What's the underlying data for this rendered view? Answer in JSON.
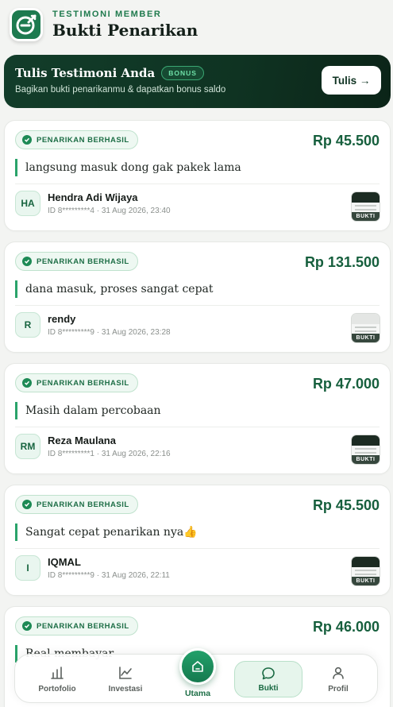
{
  "header": {
    "eyebrow": "TESTIMONI MEMBER",
    "title": "Bukti Penarikan"
  },
  "banner": {
    "title": "Tulis Testimoni Anda",
    "badge": "BONUS",
    "subtitle": "Bagikan bukti penarikanmu & dapatkan bonus saldo",
    "button_label": "Tulis →"
  },
  "cards": [
    {
      "status": "PENARIKAN BERHASIL",
      "amount": "Rp 45.500",
      "message": "langsung masuk dong gak pakek lama",
      "initials": "HA",
      "name": "Hendra Adi Wijaya",
      "meta": "ID 8*********4 · 31 Aug 2026, 23:40",
      "proof_label": "BUKTI"
    },
    {
      "status": "PENARIKAN BERHASIL",
      "amount": "Rp 131.500",
      "message": "dana masuk, proses sangat cepat",
      "initials": "R",
      "name": "rendy",
      "meta": "ID 8*********9 · 31 Aug 2026, 23:28",
      "proof_label": "BUKTI"
    },
    {
      "status": "PENARIKAN BERHASIL",
      "amount": "Rp 47.000",
      "message": "Masih dalam percobaan",
      "initials": "RM",
      "name": "Reza Maulana",
      "meta": "ID 8*********1 · 31 Aug 2026, 22:16",
      "proof_label": "BUKTI"
    },
    {
      "status": "PENARIKAN BERHASIL",
      "amount": "Rp 45.500",
      "message": "Sangat cepat penarikan nya👍",
      "initials": "I",
      "name": "IQMAL",
      "meta": "ID 8*********9 · 31 Aug 2026, 22:11",
      "proof_label": "BUKTI"
    },
    {
      "status": "PENARIKAN BERHASIL",
      "amount": "Rp 46.000",
      "message": "Real membayar"
    }
  ],
  "nav": {
    "portfolio": "Portofolio",
    "investasi": "Investasi",
    "utama": "Utama",
    "bukti": "Bukti",
    "profil": "Profil"
  },
  "colors": {
    "accent": "#1d8a55",
    "banner_bg": "#0f3322",
    "amount": "#165f3d"
  }
}
